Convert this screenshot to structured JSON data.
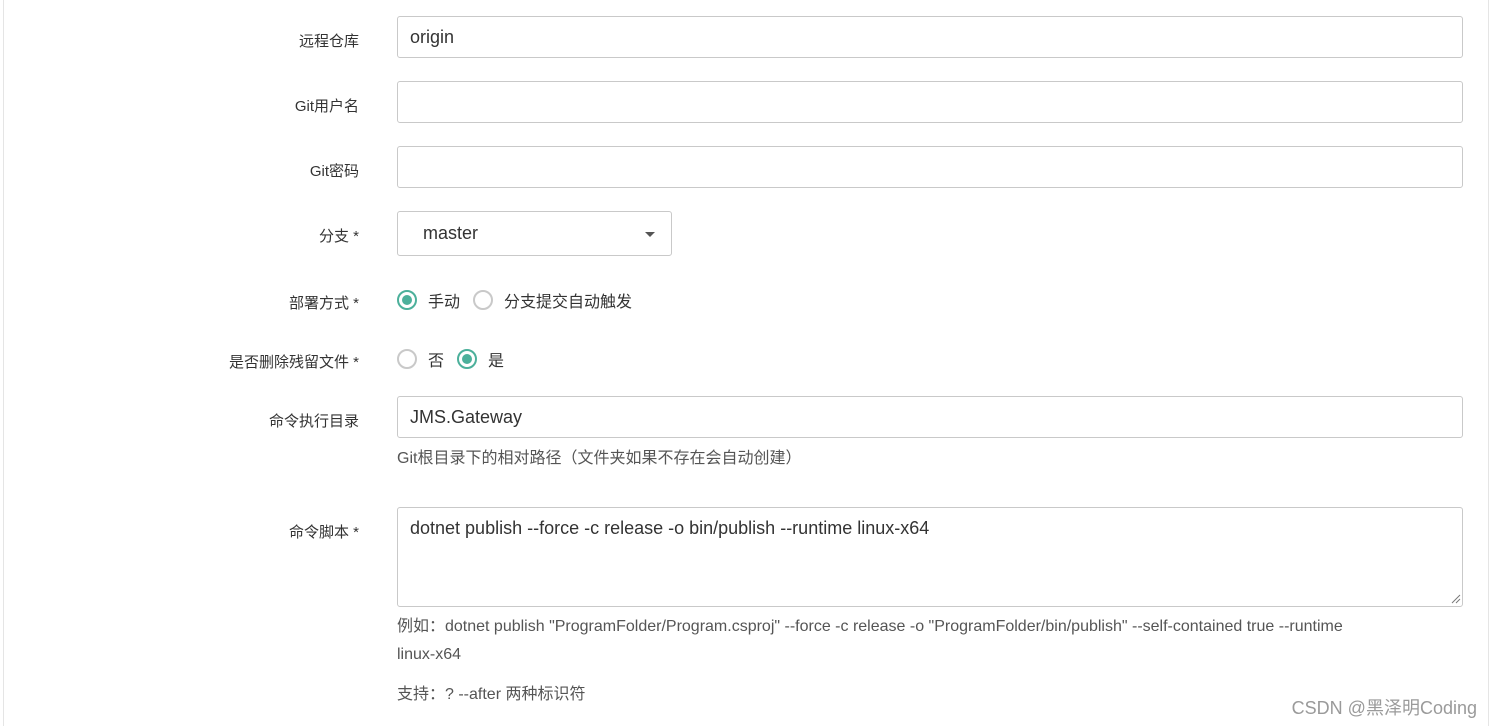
{
  "form": {
    "remote_repo": {
      "label": "远程仓库",
      "value": "origin"
    },
    "git_username": {
      "label": "Git用户名",
      "value": ""
    },
    "git_password": {
      "label": "Git密码",
      "value": ""
    },
    "branch": {
      "label": "分支 *",
      "selected": "master"
    },
    "deploy_mode": {
      "label": "部署方式 *",
      "options": [
        {
          "label": "手动",
          "checked": true
        },
        {
          "label": "分支提交自动触发",
          "checked": false
        }
      ]
    },
    "delete_residual": {
      "label": "是否删除残留文件 *",
      "options": [
        {
          "label": "否",
          "checked": false
        },
        {
          "label": "是",
          "checked": true
        }
      ]
    },
    "command_dir": {
      "label": "命令执行目录",
      "value": "JMS.Gateway",
      "help": "Git根目录下的相对路径（文件夹如果不存在会自动创建）"
    },
    "command_script": {
      "label": "命令脚本 *",
      "value": "dotnet publish --force -c release -o bin/publish --runtime linux-x64",
      "example_line1": "例如：dotnet publish \"ProgramFolder/Program.csproj\" --force -c release -o \"ProgramFolder/bin/publish\" --self-contained true --runtime",
      "example_line2": "linux-x64",
      "support": "支持：? --after 两种标识符"
    }
  },
  "watermark": "CSDN @黑泽明Coding",
  "colors": {
    "accent": "#4cb09b",
    "border": "#c9c9c9",
    "text": "#333333"
  }
}
